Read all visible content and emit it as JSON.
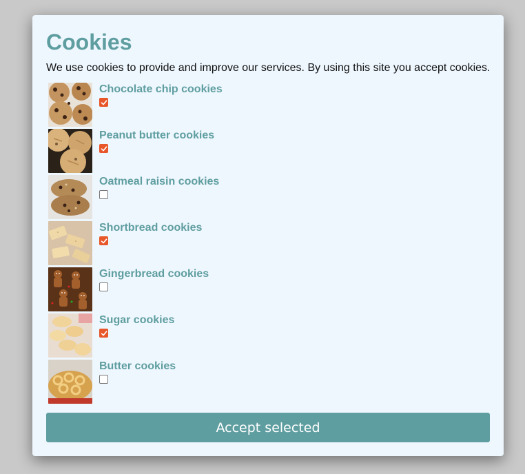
{
  "dialog": {
    "title": "Cookies",
    "description": "We use cookies to provide and improve our services. By using this site you accept cookies.",
    "accept_label": "Accept selected"
  },
  "cookies": [
    {
      "label": "Chocolate chip cookies",
      "checked": true
    },
    {
      "label": "Peanut butter cookies",
      "checked": true
    },
    {
      "label": "Oatmeal raisin cookies",
      "checked": false
    },
    {
      "label": "Shortbread cookies",
      "checked": true
    },
    {
      "label": "Gingerbread cookies",
      "checked": false
    },
    {
      "label": "Sugar cookies",
      "checked": true
    },
    {
      "label": "Butter cookies",
      "checked": false
    }
  ],
  "colors": {
    "accent": "#5f9ea0",
    "checkbox_checked": "#e8572a",
    "dialog_bg": "#eef7fe"
  }
}
